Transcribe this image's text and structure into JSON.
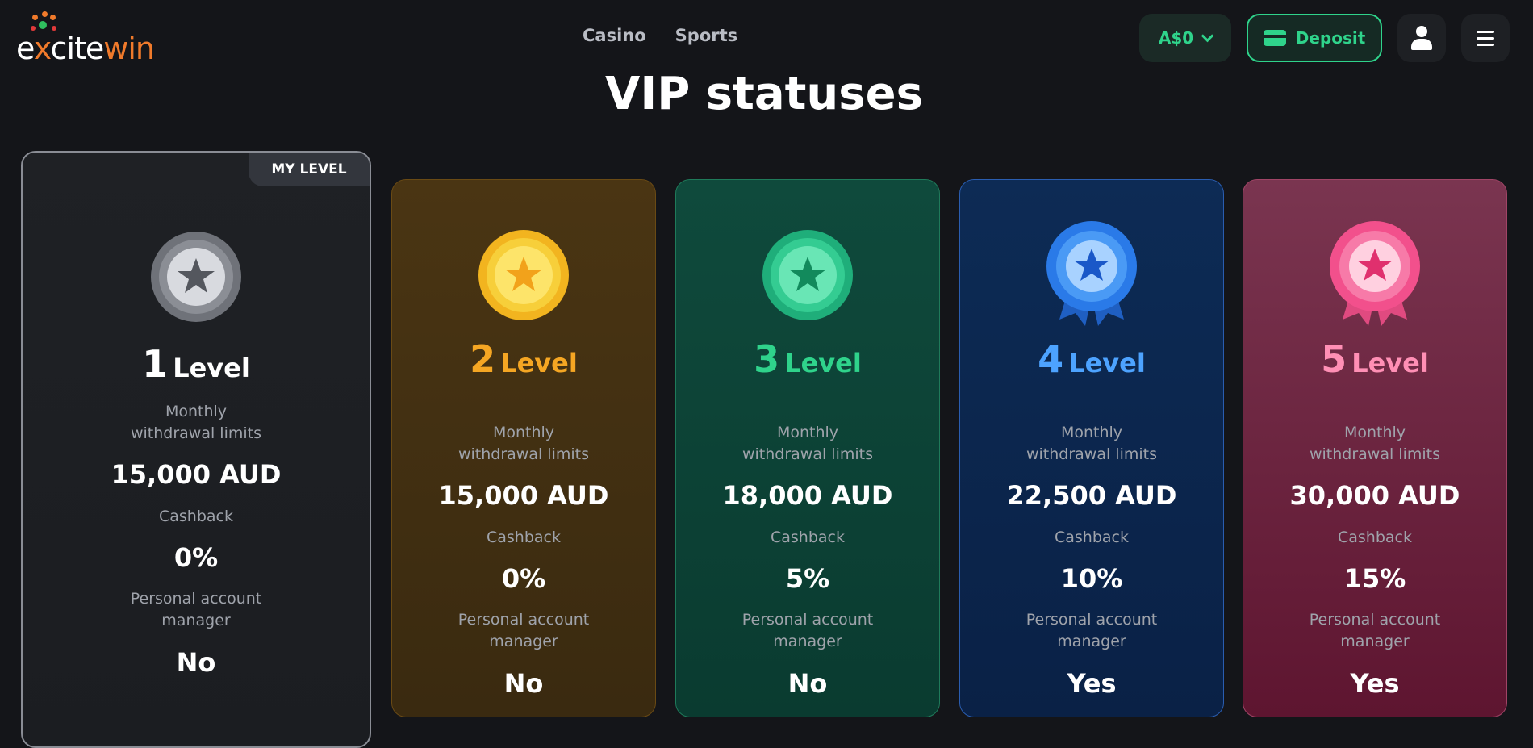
{
  "header": {
    "logo_text_white": "e",
    "logo_text_x": "x",
    "logo_text_cite": "cite",
    "logo_text_win": "win",
    "nav": [
      "Casino",
      "Sports"
    ],
    "balance": "A$0",
    "deposit_label": "Deposit"
  },
  "page_title": "VIP statuses",
  "colors": {
    "accent_green": "#2fd38b",
    "level2": "#f5a623",
    "level3": "#2fd38b",
    "level4": "#4da3ff",
    "level5": "#ff8fb5"
  },
  "levels": [
    {
      "number": "1",
      "word": "Level",
      "badge": "MY LEVEL",
      "limits_label": "Monthly\nwithdrawal limits",
      "limits": "15,000 AUD",
      "cashback_label": "Cashback",
      "cashback": "0%",
      "manager_label": "Personal account\nmanager",
      "manager": "No",
      "medal": "silver-star-medal-icon"
    },
    {
      "number": "2",
      "word": "Level",
      "limits_label": "Monthly\nwithdrawal limits",
      "limits": "15,000 AUD",
      "cashback_label": "Cashback",
      "cashback": "0%",
      "manager_label": "Personal account\nmanager",
      "manager": "No",
      "medal": "gold-star-medal-icon"
    },
    {
      "number": "3",
      "word": "Level",
      "limits_label": "Monthly\nwithdrawal limits",
      "limits": "18,000 AUD",
      "cashback_label": "Cashback",
      "cashback": "5%",
      "manager_label": "Personal account\nmanager",
      "manager": "No",
      "medal": "green-star-medal-icon"
    },
    {
      "number": "4",
      "word": "Level",
      "limits_label": "Monthly\nwithdrawal limits",
      "limits": "22,500 AUD",
      "cashback_label": "Cashback",
      "cashback": "10%",
      "manager_label": "Personal account\nmanager",
      "manager": "Yes",
      "medal": "blue-ribbon-medal-icon"
    },
    {
      "number": "5",
      "word": "Level",
      "limits_label": "Monthly\nwithdrawal limits",
      "limits": "30,000 AUD",
      "cashback_label": "Cashback",
      "cashback": "15%",
      "manager_label": "Personal account\nmanager",
      "manager": "Yes",
      "medal": "pink-ribbon-medal-icon"
    }
  ]
}
